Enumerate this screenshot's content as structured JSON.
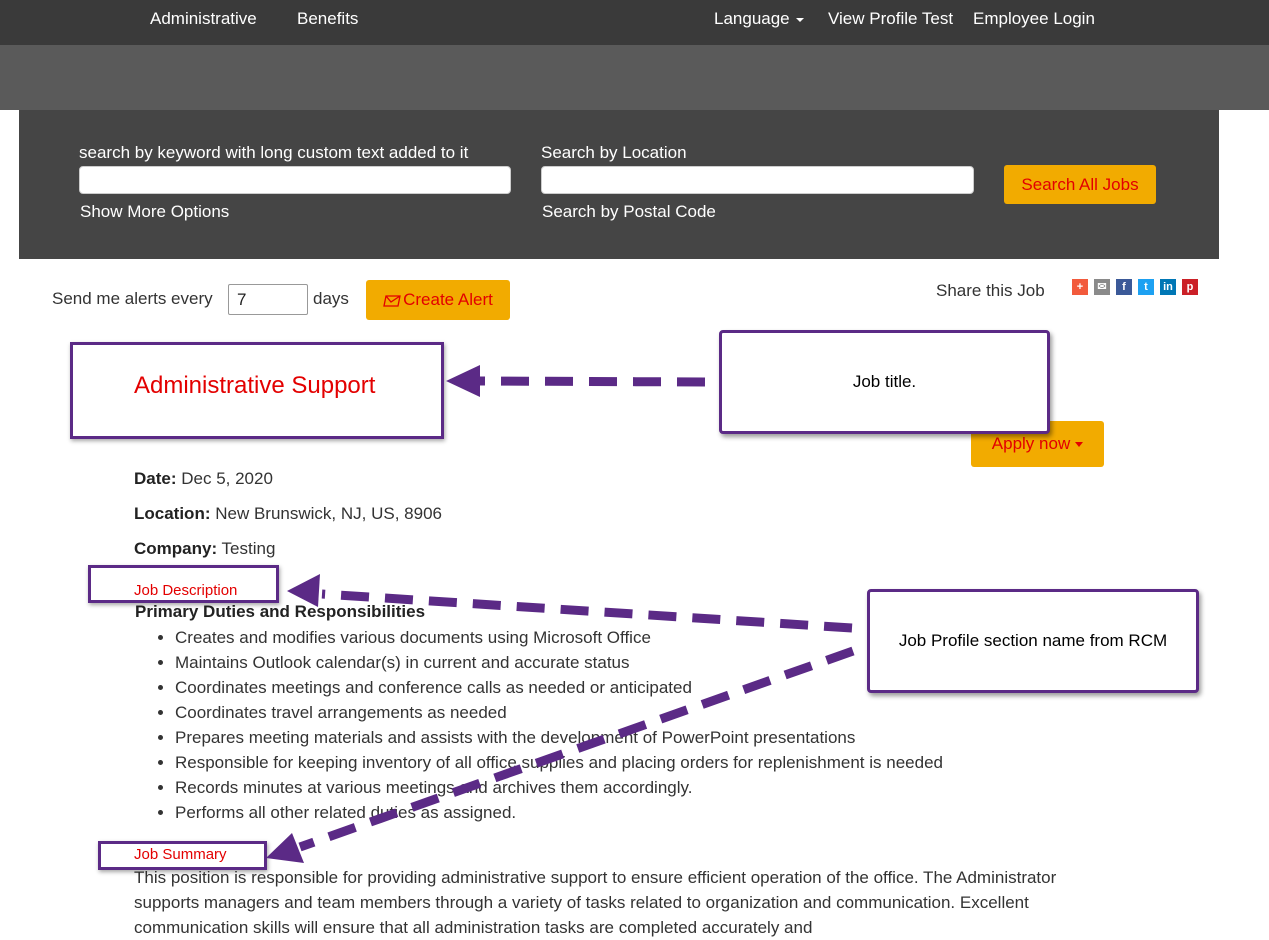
{
  "top_nav": {
    "items": [
      {
        "label": "Administrative"
      },
      {
        "label": "Benefits"
      },
      {
        "label": "Language"
      },
      {
        "label": "View Profile Test"
      },
      {
        "label": "Employee Login"
      }
    ]
  },
  "search": {
    "keyword_label": "search by keyword with long custom text added to it",
    "location_label": "Search by Location",
    "more_options": "Show More Options",
    "postal_code": "Search by Postal Code",
    "search_button": "Search All Jobs"
  },
  "alerts": {
    "prefix": "Send me alerts every",
    "days_value": "7",
    "suffix": "days",
    "create_button": "Create Alert"
  },
  "share": {
    "label": "Share this Job",
    "icons": [
      "plus-share-icon",
      "email-icon",
      "facebook-icon",
      "twitter-icon",
      "linkedin-icon",
      "pinterest-icon"
    ]
  },
  "job": {
    "title": "Administrative Support",
    "apply_button": "Apply now",
    "date_label": "Date:",
    "date_value": "Dec 5, 2020",
    "location_label": "Location:",
    "location_value": "New Brunswick, NJ, US, 8906",
    "company_label": "Company:",
    "company_value": "Testing",
    "description_heading": "Job Description",
    "duties_heading": "Primary Duties and Responsibilities",
    "duties": [
      "Creates and modifies various documents using Microsoft Office",
      "Maintains Outlook calendar(s) in current and accurate status",
      "Coordinates meetings and conference calls as needed or anticipated",
      "Coordinates travel arrangements as needed",
      "Prepares meeting materials and assists with the development of PowerPoint presentations",
      "Responsible for keeping inventory of all office supplies and placing orders for replenishment is needed",
      "Records minutes at various meetings and archives them accordingly.",
      "Performs all other related duties as assigned."
    ],
    "summary_heading": "Job Summary",
    "summary_text": "This position is responsible for providing administrative support to ensure efficient operation of the office. The Administrator supports managers and team members through a variety of tasks related to organization and communication. Excellent communication skills will ensure that all administration tasks are completed accurately and"
  },
  "annotations": {
    "job_title_callout": "Job title.",
    "section_callout": "Job Profile section name from RCM"
  },
  "colors": {
    "accent_red": "#e30000",
    "button_yellow": "#f2ab00",
    "annotation_purple": "#5b2a86",
    "nav_dark": "#3a3a3a",
    "search_panel": "#454545"
  }
}
